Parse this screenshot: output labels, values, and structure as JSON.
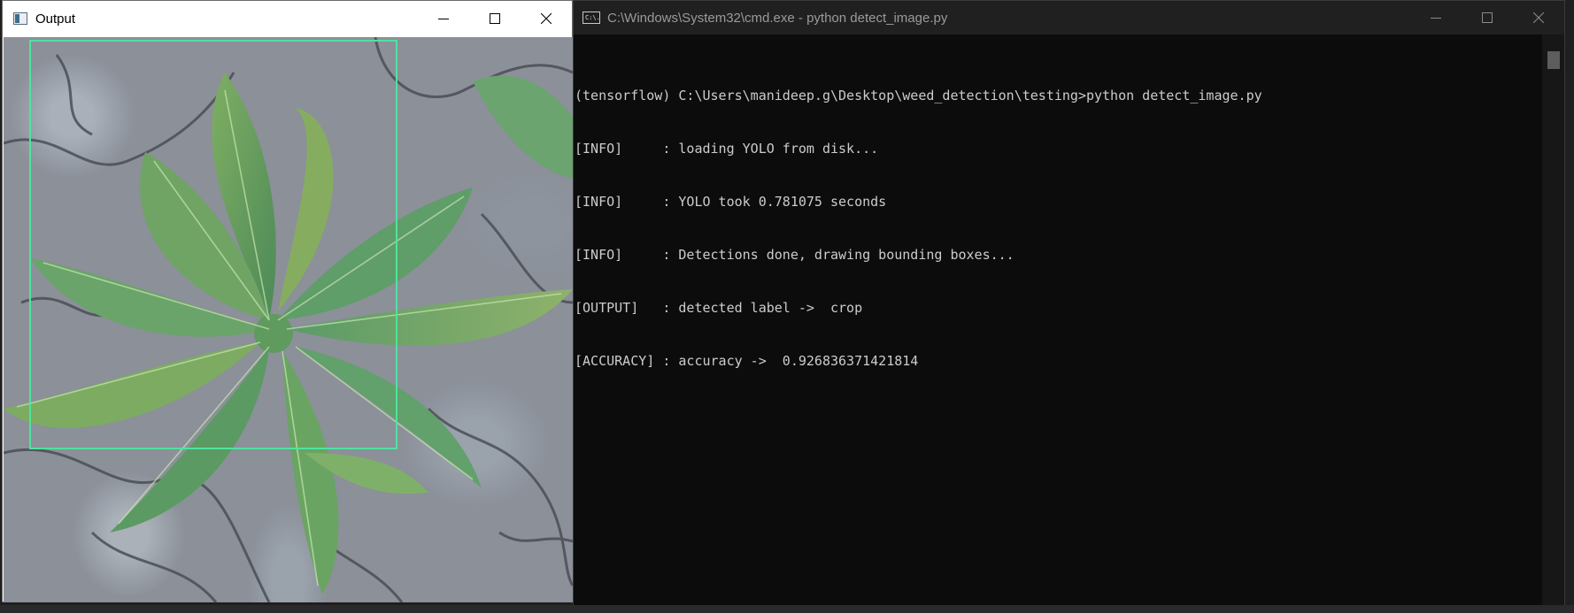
{
  "output_window": {
    "title": "Output",
    "image_description_icon": "image-window-icon",
    "detection": {
      "box_color": "#4fe3a0",
      "label": "crop"
    },
    "controls": [
      "minimize-icon",
      "maximize-icon",
      "close-icon"
    ]
  },
  "cmd_window": {
    "title": "C:\\Windows\\System32\\cmd.exe - python  detect_image.py",
    "icon_label": "C:\\.",
    "controls": [
      "minimize-icon",
      "maximize-icon",
      "close-icon"
    ],
    "lines": [
      "(tensorflow) C:\\Users\\manideep.g\\Desktop\\weed_detection\\testing>python detect_image.py",
      "[INFO]     : loading YOLO from disk...",
      "[INFO]     : YOLO took 0.781075 seconds",
      "[INFO]     : Detections done, drawing bounding boxes...",
      "[OUTPUT]   : detected label ->  crop",
      "[ACCURACY] : accuracy ->  0.926836371421814"
    ]
  },
  "colors": {
    "terminal_bg": "#0c0c0c",
    "terminal_fg": "#cccccc",
    "cmd_titlebar": "#202020",
    "box": "#4fe3a0"
  }
}
